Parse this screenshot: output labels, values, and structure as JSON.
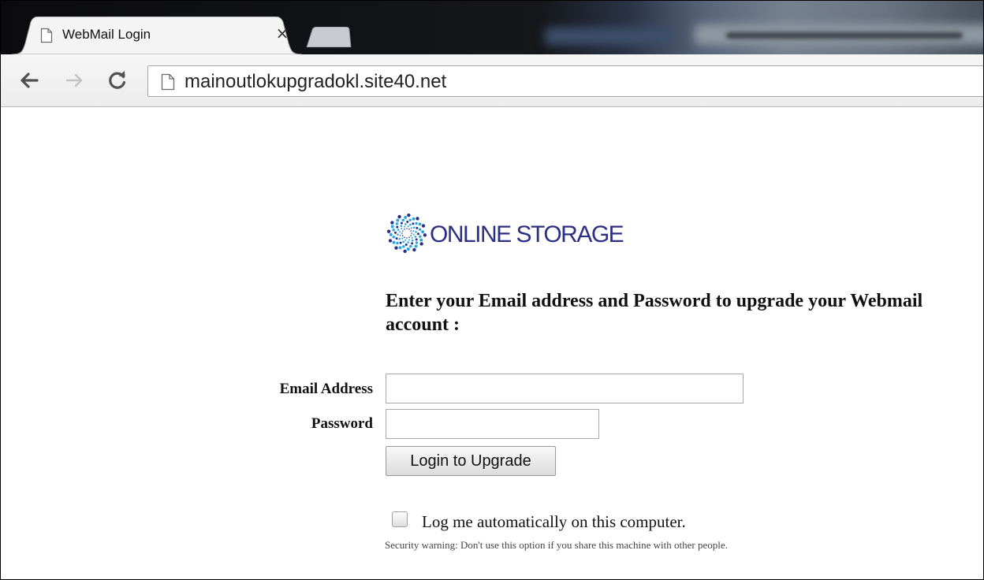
{
  "browser": {
    "tab_title": "WebMail Login",
    "tab_close_glyph": "×",
    "url": "mainoutlokupgradokl.site40.net",
    "icons": {
      "back": "back-arrow-icon",
      "forward": "forward-arrow-icon",
      "reload": "reload-icon",
      "page": "page-icon",
      "close": "close-icon"
    }
  },
  "page": {
    "logo_text": "ONLINE STORAGE",
    "heading": "Enter your Email address and Password to upgrade your Webmail account :",
    "form": {
      "email_label": "Email Address",
      "email_value": "",
      "password_label": "Password",
      "password_value": "",
      "submit_label": "Login to Upgrade"
    },
    "remember": {
      "checked": false,
      "label": "Log me automatically on this computer."
    },
    "warning": "Security warning: Don't use this option if you share this machine with other people."
  },
  "colors": {
    "logo_text": "#2c2f83",
    "logo_dots": "#2aa6e0"
  }
}
